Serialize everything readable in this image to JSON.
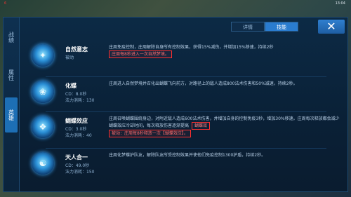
{
  "hud": {
    "left_text": "6",
    "right_text": "13:04"
  },
  "side_tabs": [
    "战绩",
    "属性",
    "英雄"
  ],
  "top_tabs": [
    "详情",
    "技能"
  ],
  "close_label": "✕",
  "skills": [
    {
      "icon": "✦",
      "name": "自然意志",
      "meta1": "被动",
      "meta2": "",
      "desc": "庄周免疫控制，庄周解除自身所有控制效果，获得15%减伤，并增加15%移速，持续2秒",
      "highlight_text": "庄周每8秒进入一次自然梦境。",
      "highlight_pill": ""
    },
    {
      "icon": "❀",
      "name": "化蝶",
      "meta1": "CD：8.0秒",
      "meta2": "法力消耗：130",
      "desc": "庄周进入自然梦境并召化出蝴蝶飞向前方，对路径上的敌人造成800法术伤害和50%减速，持续2秒。",
      "highlight_text": "",
      "highlight_pill": ""
    },
    {
      "icon": "❖",
      "name": "蝴蝶效应",
      "meta1": "CD：3.0秒",
      "meta2": "法力消耗：40",
      "desc": "庄周召唤蝴蝶围绕身边，对附近敌人造成600法术伤害，并增加自身的控制免疫3秒，增加30%移速。庄周每次释放都会减少蝴蝶效应冷却时间，每次释放伤害逐渐提高",
      "highlight_text": "被动：庄周每8秒释放一次【蝴蝶效应】。",
      "highlight_pill": "蝴蝶效"
    },
    {
      "icon": "☯",
      "name": "天人合一",
      "meta1": "CD：49.0秒",
      "meta2": "法力消耗：150",
      "desc": "庄周化梦蝶护队友，解除队友所受控制效果并使他们免疫控制1300护盾，持续2秒。",
      "highlight_text": "",
      "highlight_pill": ""
    }
  ]
}
